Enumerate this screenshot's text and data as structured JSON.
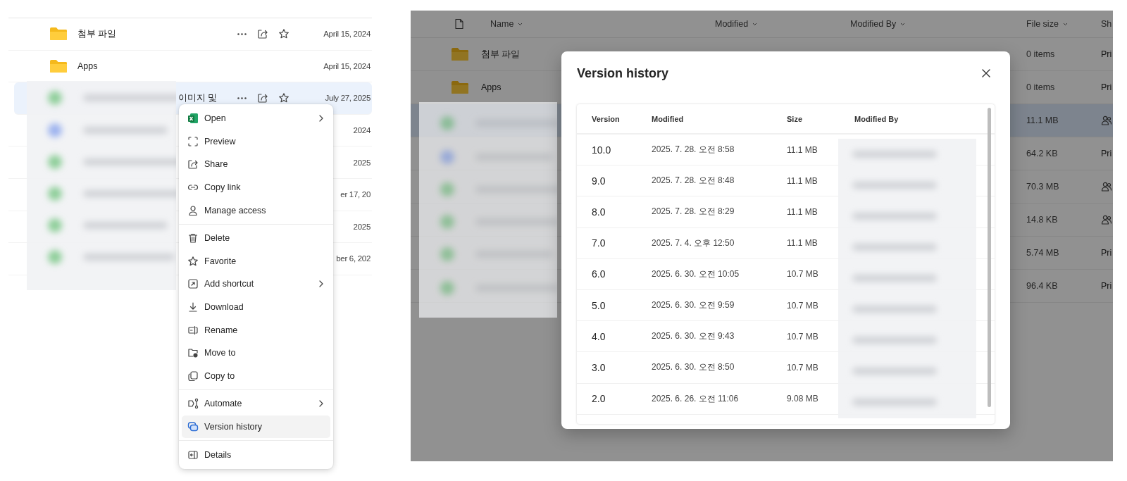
{
  "left_view": {
    "rows": [
      {
        "kind": "folder",
        "name": "첨부 파일",
        "date": "April 15, 2024",
        "show_actions": true,
        "selected": false
      },
      {
        "kind": "folder",
        "name": "Apps",
        "date": "April 15, 2024",
        "show_actions": false,
        "selected": false
      },
      {
        "kind": "file",
        "name": "이미지 및",
        "date": "July 27, 2025",
        "show_actions": true,
        "selected": true
      },
      {
        "kind": "file",
        "date": "2024",
        "selected": false
      },
      {
        "kind": "file",
        "date": "2025",
        "selected": false
      },
      {
        "kind": "file",
        "date": "er 17, 20",
        "selected": false
      },
      {
        "kind": "file",
        "date": "2025",
        "selected": false
      },
      {
        "kind": "file",
        "date": "ber 6, 202",
        "selected": false
      }
    ],
    "context_menu": {
      "groups": [
        [
          {
            "label": "Open",
            "submenu": true,
            "highlighted": false
          },
          {
            "label": "Preview",
            "submenu": false,
            "highlighted": false
          },
          {
            "label": "Share",
            "submenu": false,
            "highlighted": false
          },
          {
            "label": "Copy link",
            "submenu": false,
            "highlighted": false
          },
          {
            "label": "Manage access",
            "submenu": false,
            "highlighted": false
          }
        ],
        [
          {
            "label": "Delete",
            "submenu": false,
            "highlighted": false
          },
          {
            "label": "Favorite",
            "submenu": false,
            "highlighted": false
          },
          {
            "label": "Add shortcut",
            "submenu": true,
            "highlighted": false
          },
          {
            "label": "Download",
            "submenu": false,
            "highlighted": false
          },
          {
            "label": "Rename",
            "submenu": false,
            "highlighted": false
          },
          {
            "label": "Move to",
            "submenu": false,
            "highlighted": false
          },
          {
            "label": "Copy to",
            "submenu": false,
            "highlighted": false
          }
        ],
        [
          {
            "label": "Automate",
            "submenu": true,
            "highlighted": false
          },
          {
            "label": "Version history",
            "submenu": false,
            "highlighted": true
          }
        ],
        [
          {
            "label": "Details",
            "submenu": false,
            "highlighted": false
          }
        ]
      ]
    }
  },
  "right_view": {
    "columns": [
      {
        "kind": "icon"
      },
      {
        "kind": "text",
        "label": "Name",
        "sortable": true
      },
      {
        "kind": "text",
        "label": "Modified",
        "sortable": true
      },
      {
        "kind": "text",
        "label": "Modified By",
        "sortable": true
      },
      {
        "kind": "text",
        "label": "File size",
        "sortable": true
      },
      {
        "kind": "text",
        "label": "Sh",
        "sortable": false
      }
    ],
    "rows": [
      {
        "kind": "folder",
        "name": "첨부 파일",
        "file_size": "0 items",
        "sharing": {
          "kind": "text",
          "text": "Pri"
        },
        "selected": false
      },
      {
        "kind": "folder",
        "name": "Apps",
        "file_size": "0 items",
        "sharing": {
          "kind": "text",
          "text": "Pri"
        },
        "selected": false
      },
      {
        "kind": "file",
        "file_size": "11.1 MB",
        "sharing": {
          "kind": "icon"
        },
        "selected": true
      },
      {
        "kind": "file",
        "file_size": "64.2 KB",
        "sharing": {
          "kind": "text",
          "text": "Pri"
        },
        "selected": false
      },
      {
        "kind": "file",
        "file_size": "70.3 MB",
        "sharing": {
          "kind": "icon"
        },
        "selected": false
      },
      {
        "kind": "file",
        "file_size": "14.8 KB",
        "sharing": {
          "kind": "icon"
        },
        "selected": false
      },
      {
        "kind": "file",
        "file_size": "5.74 MB",
        "sharing": {
          "kind": "text",
          "text": "Pri"
        },
        "selected": false
      },
      {
        "kind": "file",
        "file_size": "96.4 KB",
        "sharing": {
          "kind": "text",
          "text": "Pri"
        },
        "selected": false
      }
    ],
    "dialog": {
      "title": "Version history",
      "columns": [
        "Version",
        "Modified",
        "Size",
        "Modified By"
      ],
      "rows": [
        {
          "version": "10.0",
          "modified": "2025. 7. 28. 오전 8:58",
          "size": "11.1 MB"
        },
        {
          "version": "9.0",
          "modified": "2025. 7. 28. 오전 8:48",
          "size": "11.1 MB"
        },
        {
          "version": "8.0",
          "modified": "2025. 7. 28. 오전 8:29",
          "size": "11.1 MB"
        },
        {
          "version": "7.0",
          "modified": "2025. 7. 4. 오후 12:50",
          "size": "11.1 MB"
        },
        {
          "version": "6.0",
          "modified": "2025. 6. 30. 오전 10:05",
          "size": "10.7 MB"
        },
        {
          "version": "5.0",
          "modified": "2025. 6. 30. 오전 9:59",
          "size": "10.7 MB"
        },
        {
          "version": "4.0",
          "modified": "2025. 6. 30. 오전 9:43",
          "size": "10.7 MB"
        },
        {
          "version": "3.0",
          "modified": "2025. 6. 30. 오전 8:50",
          "size": "10.7 MB"
        },
        {
          "version": "2.0",
          "modified": "2025. 6. 26. 오전 11:06",
          "size": "9.08 MB"
        }
      ]
    }
  }
}
